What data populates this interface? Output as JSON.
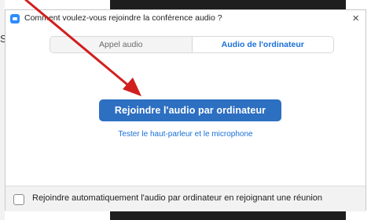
{
  "background": {
    "partial_letter": "S"
  },
  "dialog": {
    "title": "Comment voulez-vous rejoindre la conférence audio ?",
    "close_label": "×",
    "icon": "app-icon",
    "tabs": [
      {
        "label": "Appel audio",
        "active": false
      },
      {
        "label": "Audio de l'ordinateur",
        "active": true
      }
    ],
    "join_button_label": "Rejoindre l'audio par ordinateur",
    "test_link_label": "Tester le haut-parleur et le microphone",
    "auto_join_checkbox": {
      "label": "Rejoindre automatiquement l'audio par ordinateur en rejoignant une réunion",
      "checked": false
    }
  },
  "colors": {
    "primary_button": "#2d6fc1",
    "link": "#1a6fd6",
    "annotation_arrow": "#d11f1f"
  }
}
